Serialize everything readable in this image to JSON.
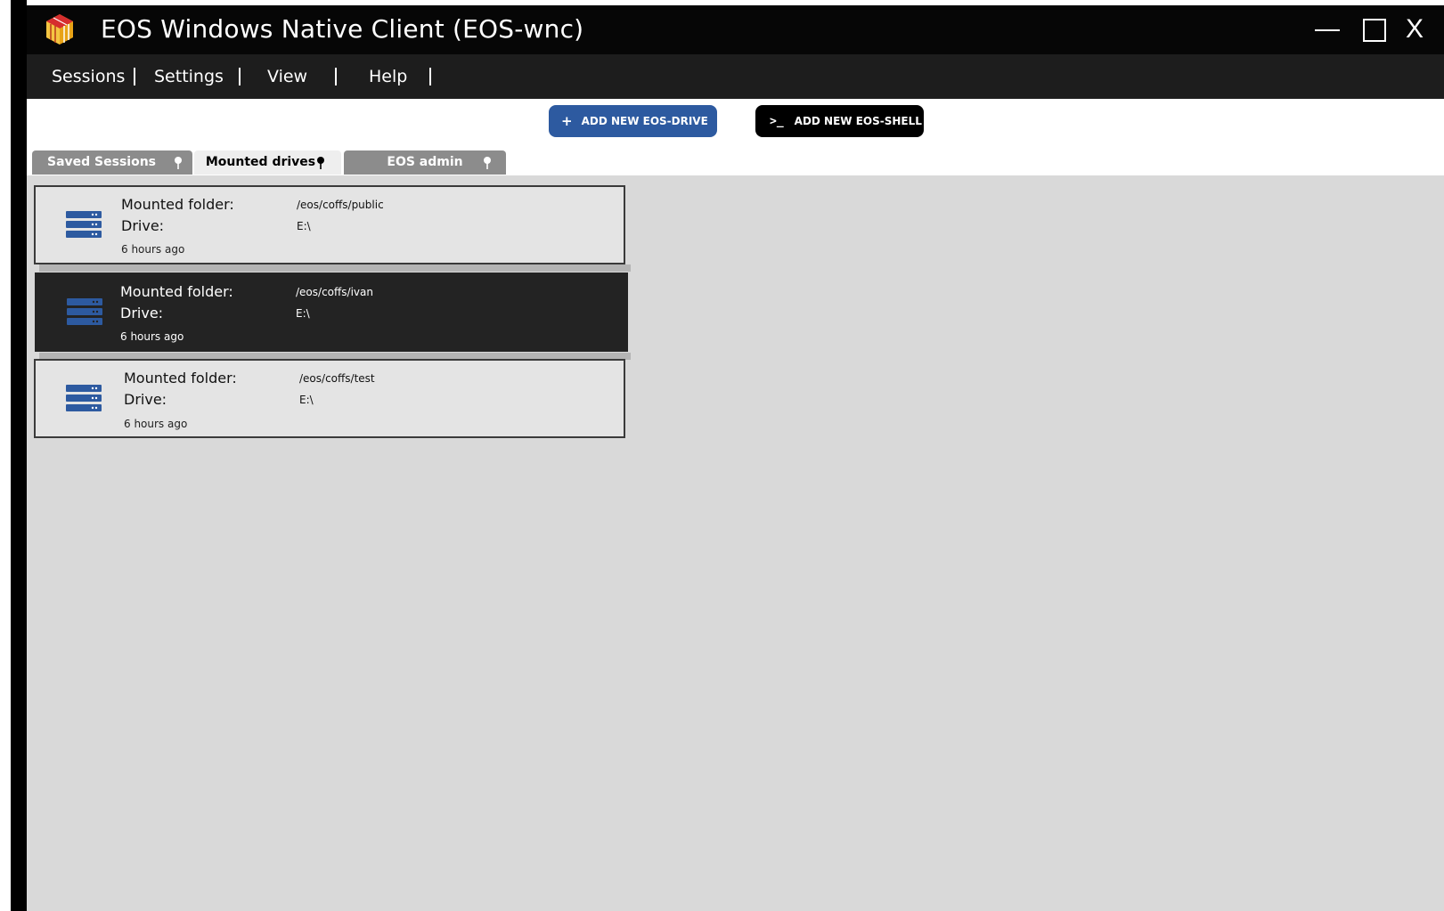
{
  "window": {
    "title": "EOS Windows Native Client (EOS-wnc)",
    "close_glyph": "X",
    "icons": {
      "logo": "eos-cube-logo",
      "minimize": "minimize-icon",
      "maximize": "maximize-icon"
    }
  },
  "menu": {
    "items": [
      "Sessions",
      "Settings",
      "View",
      "Help"
    ]
  },
  "toolbar": {
    "add_drive_icon": "+",
    "add_drive_label": "ADD NEW EOS-DRIVE",
    "add_drive_color": "#2d5aa0",
    "add_shell_icon": ">_",
    "add_shell_label": "ADD NEW EOS-SHELL"
  },
  "tabs": [
    {
      "label": "Saved Sessions",
      "active": false,
      "icon": "pin-icon"
    },
    {
      "label": "Mounted drives",
      "active": true,
      "icon": "pin-icon"
    },
    {
      "label": "EOS admin",
      "active": false,
      "icon": "pin-icon"
    }
  ],
  "drives": [
    {
      "folder_label": "Mounted folder:",
      "folder": "/eos/coffs/public",
      "drive_label": "Drive:",
      "drive": "E:\\",
      "time": "6 hours ago",
      "selected": false,
      "icon": "server-icon"
    },
    {
      "folder_label": "Mounted folder:",
      "folder": "/eos/coffs/ivan",
      "drive_label": "Drive:",
      "drive": "E:\\",
      "time": "6 hours ago",
      "selected": true,
      "icon": "server-icon"
    },
    {
      "folder_label": "Mounted folder:",
      "folder": "/eos/coffs/test",
      "drive_label": "Drive:",
      "drive": "E:\\",
      "time": "6 hours ago",
      "selected": false,
      "icon": "server-icon"
    }
  ]
}
